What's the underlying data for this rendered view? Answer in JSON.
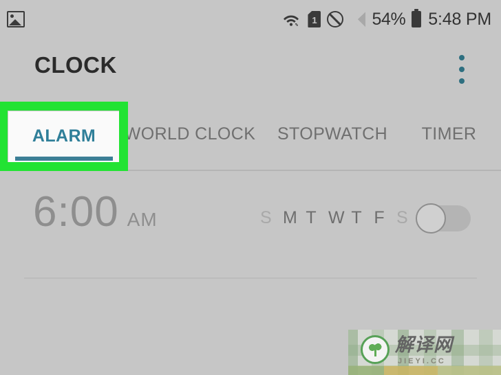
{
  "status_bar": {
    "left_icons": [
      {
        "name": "gallery-icon",
        "glyph": "image"
      }
    ],
    "right_icons": [
      {
        "name": "wifi-icon",
        "glyph": "wifi-transfer"
      },
      {
        "name": "sim-card-icon",
        "glyph": "sim",
        "label": "1"
      },
      {
        "name": "do-not-disturb-icon",
        "glyph": "no-entry"
      },
      {
        "name": "signal-icon",
        "glyph": "signal-bars"
      },
      {
        "name": "battery-icon",
        "glyph": "battery"
      }
    ],
    "battery_percent": "54%",
    "time": "5:48 PM"
  },
  "app_bar": {
    "title": "CLOCK",
    "overflow_menu": "overflow-menu-icon"
  },
  "tabs": {
    "selected_index": 0,
    "items": [
      {
        "label": "ALARM",
        "selected": true
      },
      {
        "label": "WORLD CLOCK",
        "selected": false
      },
      {
        "label": "STOPWATCH",
        "selected": false
      },
      {
        "label": "TIMER",
        "selected": false
      }
    ]
  },
  "highlight": {
    "target": "ALARM",
    "color": "#22e333"
  },
  "alarms": [
    {
      "time": "6:00",
      "meridiem": "AM",
      "days": [
        {
          "letter": "S",
          "active": false
        },
        {
          "letter": "M",
          "active": true
        },
        {
          "letter": "T",
          "active": true
        },
        {
          "letter": "W",
          "active": true
        },
        {
          "letter": "T",
          "active": true
        },
        {
          "letter": "F",
          "active": true
        },
        {
          "letter": "S",
          "active": false
        }
      ],
      "enabled": false
    }
  ],
  "watermark": {
    "cn_text": "解译网",
    "en_text": "JIEYI.CC"
  },
  "theme": {
    "background": "#c6c6c6",
    "accent": "#2f7f99",
    "text_primary": "#2b2b2b",
    "text_secondary": "#6f6f6f",
    "inactive": "#8e8e8e"
  }
}
